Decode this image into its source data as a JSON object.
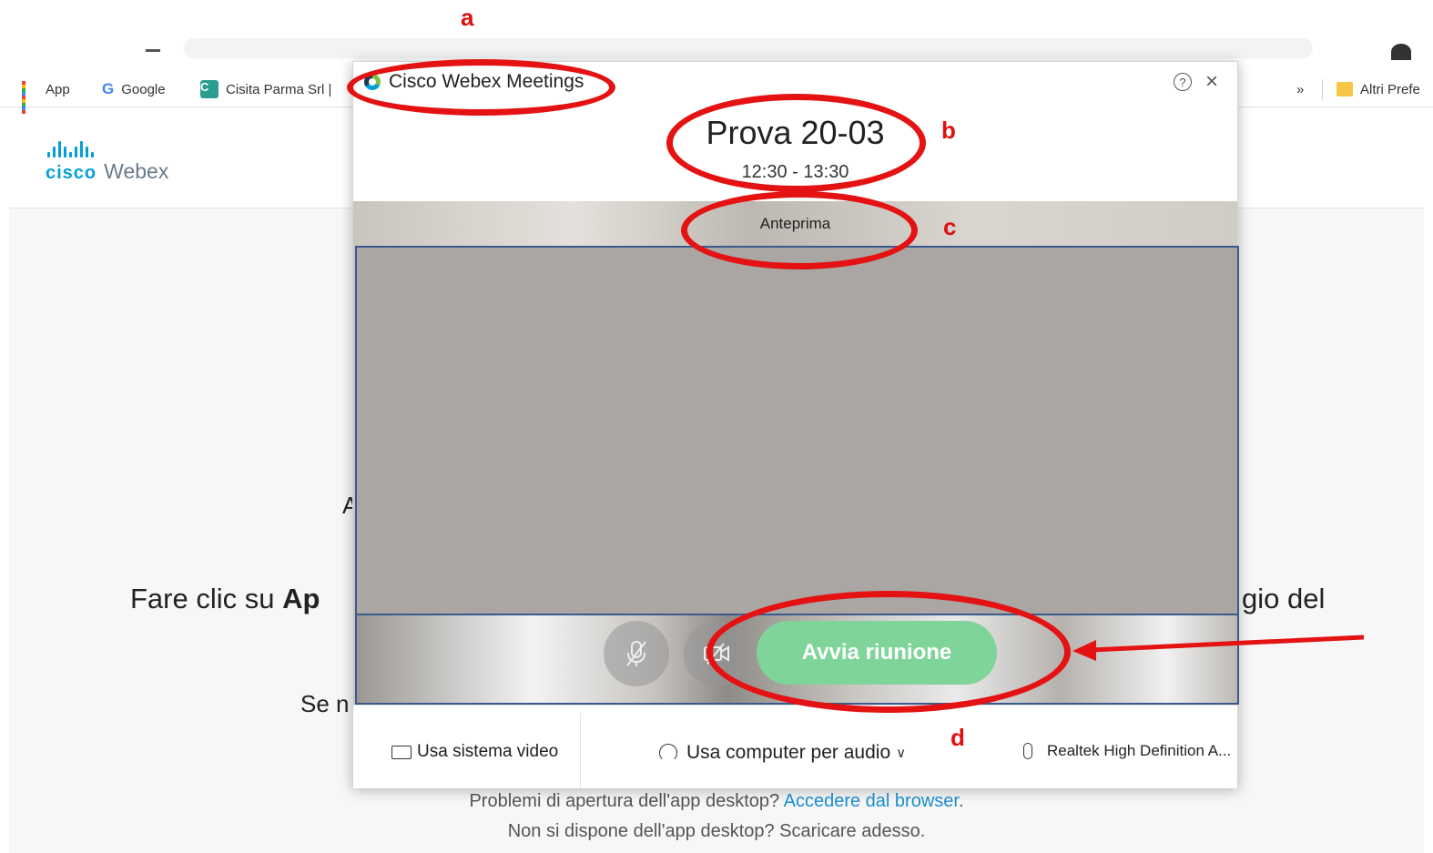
{
  "browser": {
    "bookmarks": [
      {
        "label": "App",
        "icon": "apps-grid-icon"
      },
      {
        "label": "Google",
        "icon": "google-icon"
      },
      {
        "label": "Cisita Parma Srl |",
        "icon": "cisita-icon"
      },
      {
        "label": "Altri Prefe",
        "icon": "folder-icon"
      }
    ],
    "overflow_label": "»"
  },
  "page": {
    "logo": {
      "cisco": "cisco",
      "webex": "Webex"
    },
    "fragment_left_prefix": "Fare clic su ",
    "fragment_left_bold": "Ap",
    "fragment_right": "gio del",
    "fragment_small": "Se n",
    "fragment_mark": "A",
    "problems_line1_text": "Problemi di apertura dell'app desktop? ",
    "problems_line1_link": "Accedere dal browser",
    "problems_line1_end": ".",
    "problems_line2": "Non si dispone dell'app desktop? Scaricare adesso."
  },
  "dialog": {
    "app_title": "Cisco Webex Meetings",
    "help_glyph": "?",
    "close_glyph": "×",
    "meeting_title": "Prova 20-03",
    "meeting_time": "12:30 - 13:30",
    "preview_label": "Anteprima",
    "start_button": "Avvia riunione",
    "options": {
      "video_system": "Usa sistema video",
      "audio": "Usa computer per audio",
      "audio_chevron": "∨",
      "microphone": "Realtek High Definition A..."
    }
  },
  "annotations": {
    "a": "a",
    "b": "b",
    "c": "c",
    "d": "d",
    "color": "#e01010"
  }
}
